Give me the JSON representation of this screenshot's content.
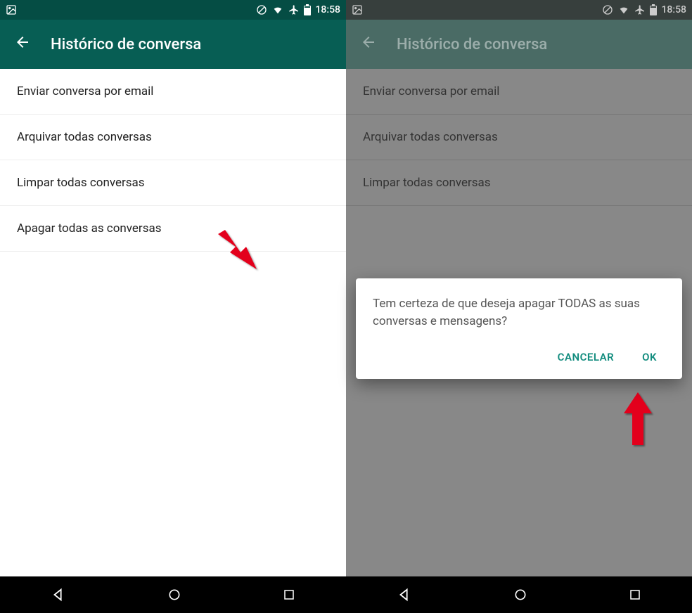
{
  "statusBar": {
    "time": "18:58"
  },
  "toolbar": {
    "title": "Histórico de conversa"
  },
  "menu": {
    "items": [
      {
        "label": "Enviar conversa por email"
      },
      {
        "label": "Arquivar todas conversas"
      },
      {
        "label": "Limpar todas conversas"
      },
      {
        "label": "Apagar todas as conversas"
      }
    ]
  },
  "dialog": {
    "message": "Tem certeza de que deseja apagar TODAS as suas conversas e mensagens?",
    "cancel": "CANCELAR",
    "ok": "OK"
  }
}
